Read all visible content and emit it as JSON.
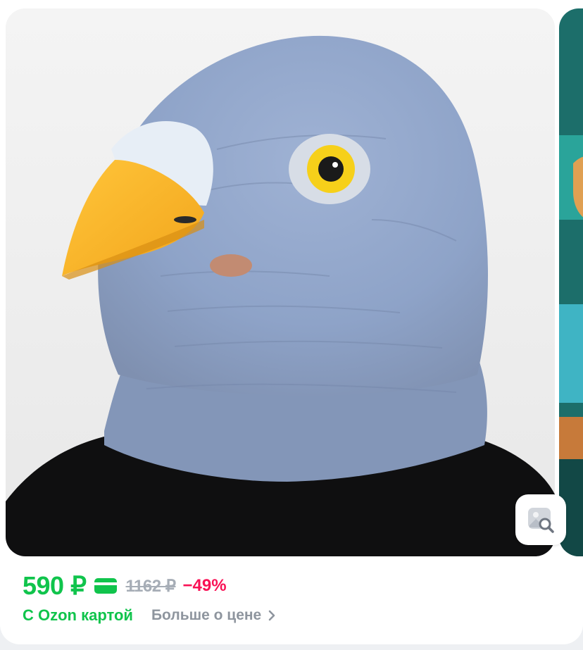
{
  "product": {
    "image_alt": "pigeon-head-latex-mask"
  },
  "price": {
    "current": "590 ₽",
    "old": "1162 ₽",
    "discount": "−49%",
    "card_label": "С Ozon картой",
    "more_label": "Больше о цене"
  },
  "colors": {
    "price_green": "#10c44c",
    "discount_pink": "#f91155",
    "muted_gray": "#8e959e"
  },
  "icons": {
    "card": "bank-card-icon",
    "photo_search": "image-search-icon",
    "chevron": "chevron-right-icon"
  }
}
